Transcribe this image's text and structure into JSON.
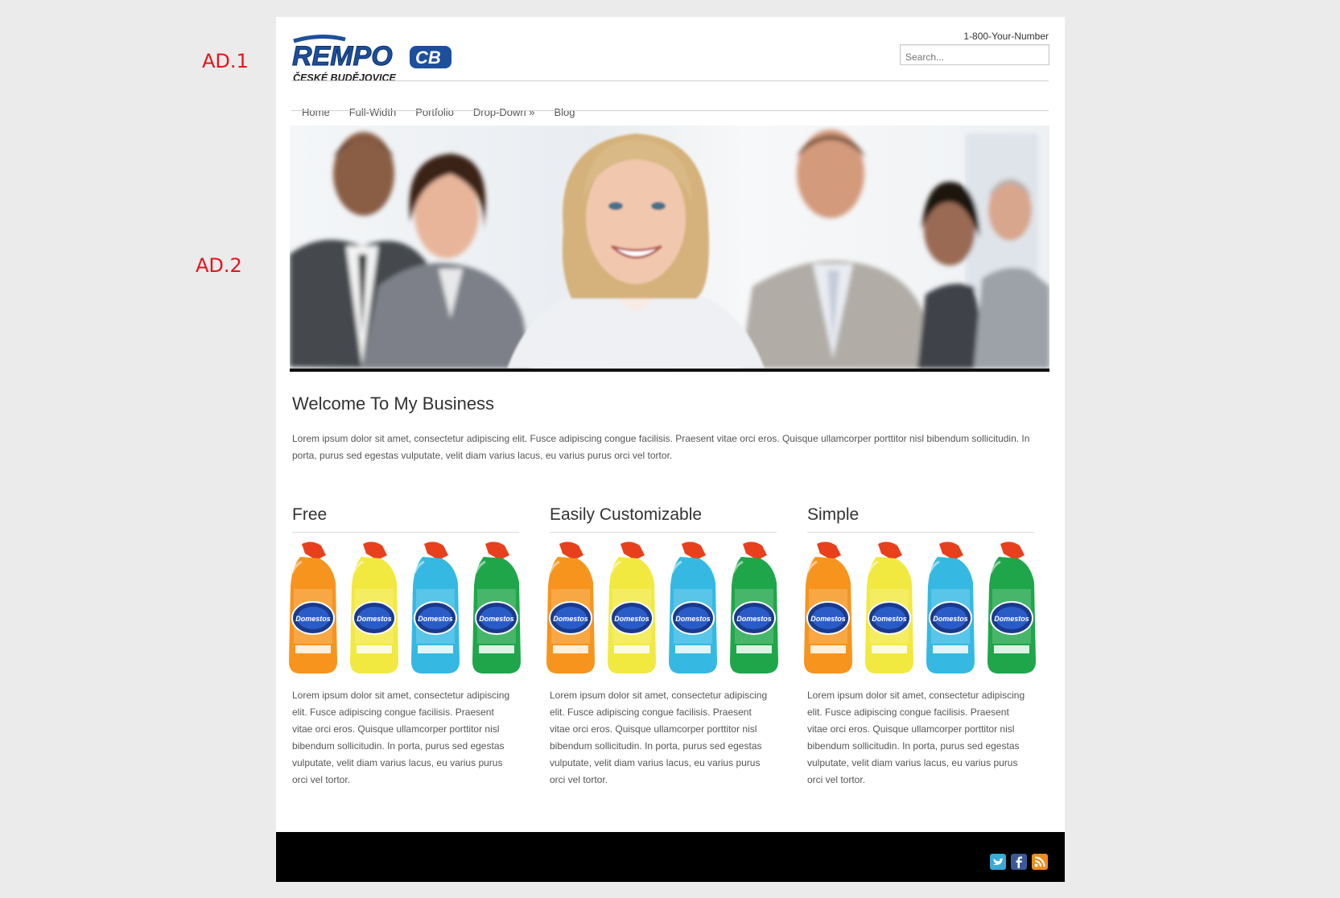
{
  "annotations": {
    "ad1": "AD.1",
    "ad2": "AD.2"
  },
  "header": {
    "logo_text": "REMPO",
    "logo_suffix": "CB",
    "logo_tagline": "ČESKÉ BUDĚJOVICE",
    "phone": "1-800-Your-Number",
    "search_placeholder": "Search..."
  },
  "nav": [
    "Home",
    "Full-Width",
    "Portfolio",
    "Drop-Down »",
    "Blog"
  ],
  "welcome": {
    "title": "Welcome To My Business",
    "text": "Lorem ipsum dolor sit amet, consectetur adipiscing elit. Fusce adipiscing congue facilisis. Praesent vitae orci eros. Quisque ullamcorper porttitor nisl bibendum sollicitudin. In porta, purus sed egestas vulputate, velit diam varius lacus, eu varius purus orci vel tortor."
  },
  "columns": [
    {
      "title": "Free",
      "text": "Lorem ipsum dolor sit amet, consectetur adipiscing elit. Fusce adipiscing congue facilisis. Praesent vitae orci eros. Quisque ullamcorper porttitor nisl bibendum sollicitudin. In porta, purus sed egestas vulputate, velit diam varius lacus, eu varius purus orci vel tortor."
    },
    {
      "title": "Easily Customizable",
      "text": "Lorem ipsum dolor sit amet, consectetur adipiscing elit. Fusce adipiscing congue facilisis. Praesent vitae orci eros. Quisque ullamcorper porttitor nisl bibendum sollicitudin. In porta, purus sed egestas vulputate, velit diam varius lacus, eu varius purus orci vel tortor."
    },
    {
      "title": "Simple",
      "text": "Lorem ipsum dolor sit amet, consectetur adipiscing elit. Fusce adipiscing congue facilisis. Praesent vitae orci eros. Quisque ullamcorper porttitor nisl bibendum sollicitudin. In porta, purus sed egestas vulputate, velit diam varius lacus, eu varius purus orci vel tortor."
    }
  ],
  "product_label": "Domestos",
  "bottle_colors": [
    "#f7941d",
    "#f2e940",
    "#35b9e3",
    "#1fa64a"
  ],
  "social_icons": [
    "twitter-icon",
    "facebook-icon",
    "rss-icon"
  ],
  "colors": {
    "annotation": "#e8141a",
    "page_bg": "#ebebeb",
    "footer": "#000000"
  }
}
